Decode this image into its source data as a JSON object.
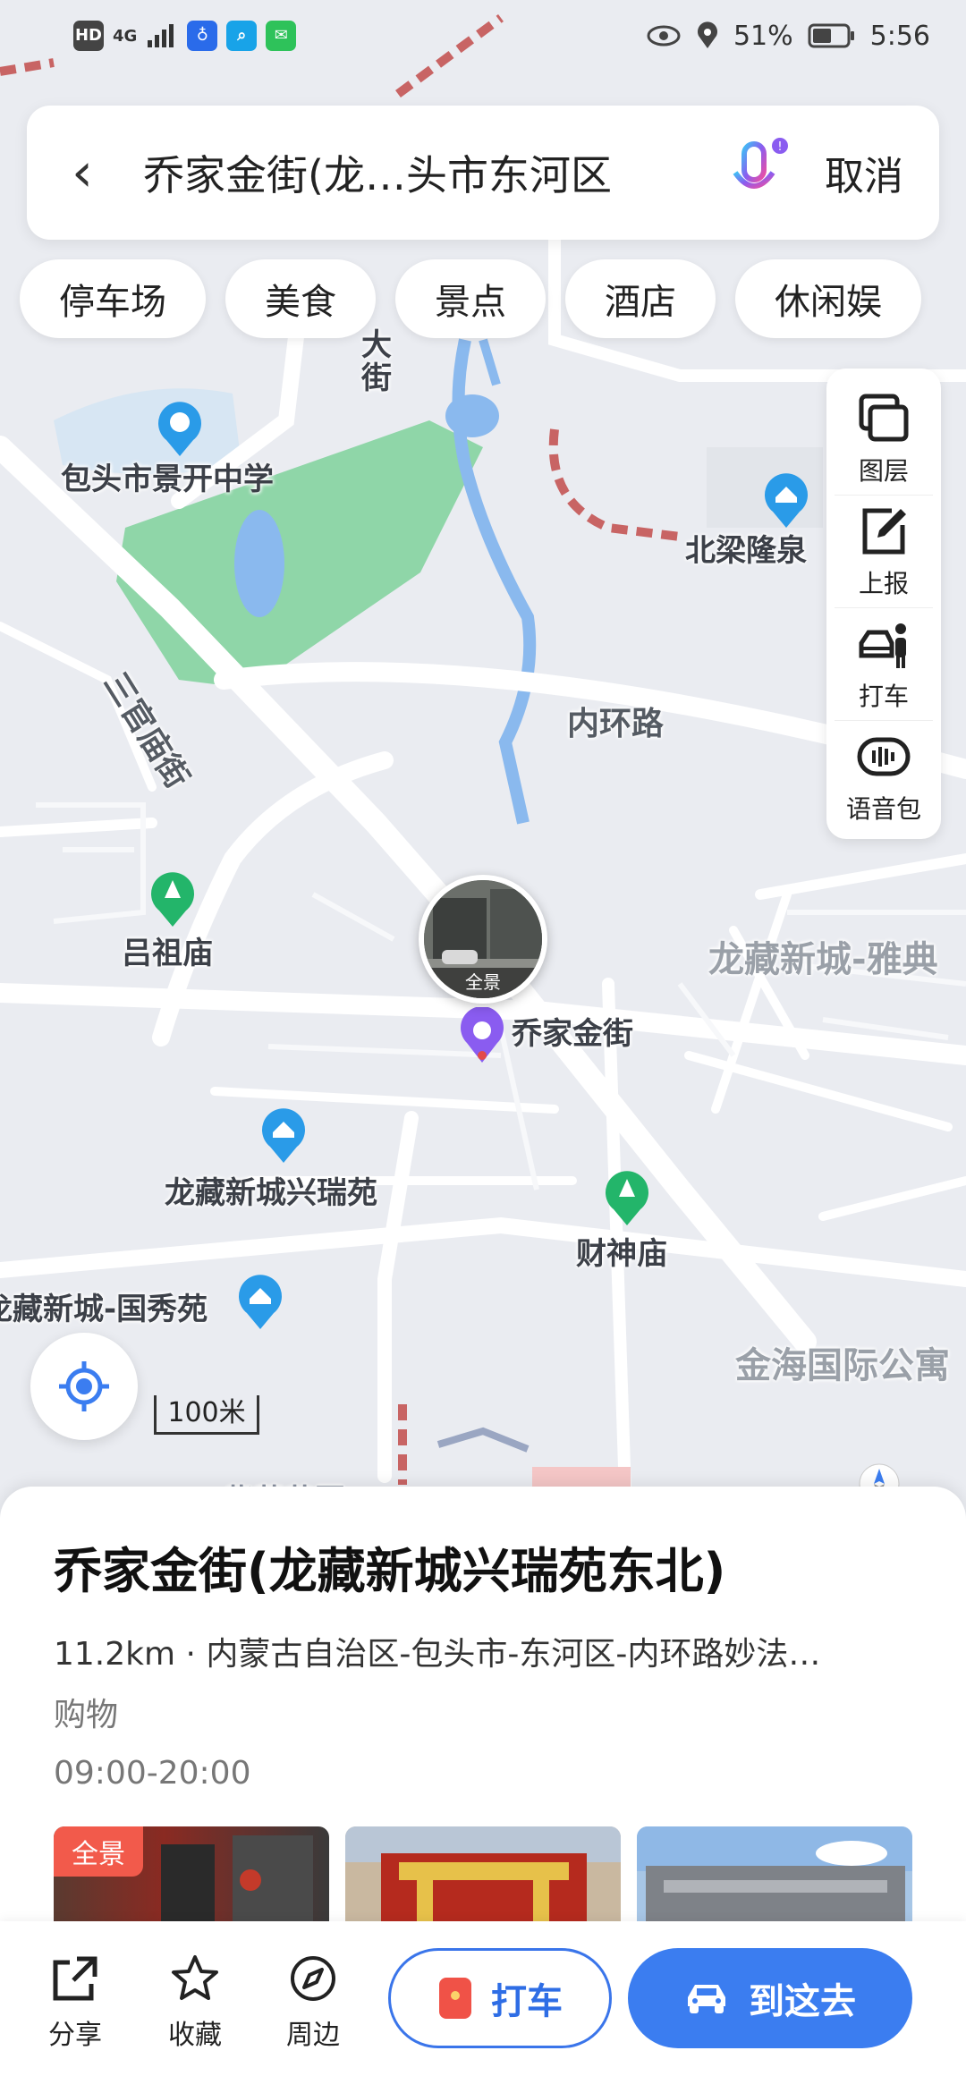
{
  "status_bar": {
    "network_badge": "HD",
    "signal_text": "4G",
    "battery": "51%",
    "time": "5:56"
  },
  "search": {
    "query": "乔家金街(龙…头市东河区",
    "cancel_label": "取消"
  },
  "chips": [
    "停车场",
    "美食",
    "景点",
    "酒店",
    "休闲娱"
  ],
  "tools": [
    {
      "label": "图层",
      "icon": "layers-icon"
    },
    {
      "label": "上报",
      "icon": "report-edit-icon"
    },
    {
      "label": "打车",
      "icon": "taxi-person-icon"
    },
    {
      "label": "语音包",
      "icon": "voice-pack-icon"
    }
  ],
  "map": {
    "labels": {
      "school": "包头市景开中学",
      "street_top": "大街",
      "hutong": "三官庙街",
      "inner_ring": "内环路",
      "beiliang": "北梁隆泉",
      "lvzu": "吕祖庙",
      "longcang_yadian": "龙藏新城-雅典",
      "qiaojia": "乔家金街",
      "xingruiyuan": "龙藏新城兴瑞苑",
      "caishen": "财神庙",
      "guoxiuyuan": "龙藏新城-国秀苑",
      "jinhai": "金海国际公寓",
      "zicang": "紫薇花园"
    },
    "pano_caption": "全景",
    "scale_label": "100米"
  },
  "sheet": {
    "title": "乔家金街(龙藏新城兴瑞苑东北)",
    "address": "11.2km · 内蒙古自治区-包头市-东河区-内环路妙法…",
    "category": "购物",
    "hours": "09:00-20:00",
    "photo_tag": "全景"
  },
  "actions": {
    "share": "分享",
    "favorite": "收藏",
    "nearby": "周边",
    "taxi": "打车",
    "go": "到这去"
  },
  "colors": {
    "accent": "#3b7df0",
    "park": "#8fd6a8",
    "water": "#8ab9ee",
    "poi_blue": "#2a9be8",
    "poi_green": "#23b56a"
  }
}
